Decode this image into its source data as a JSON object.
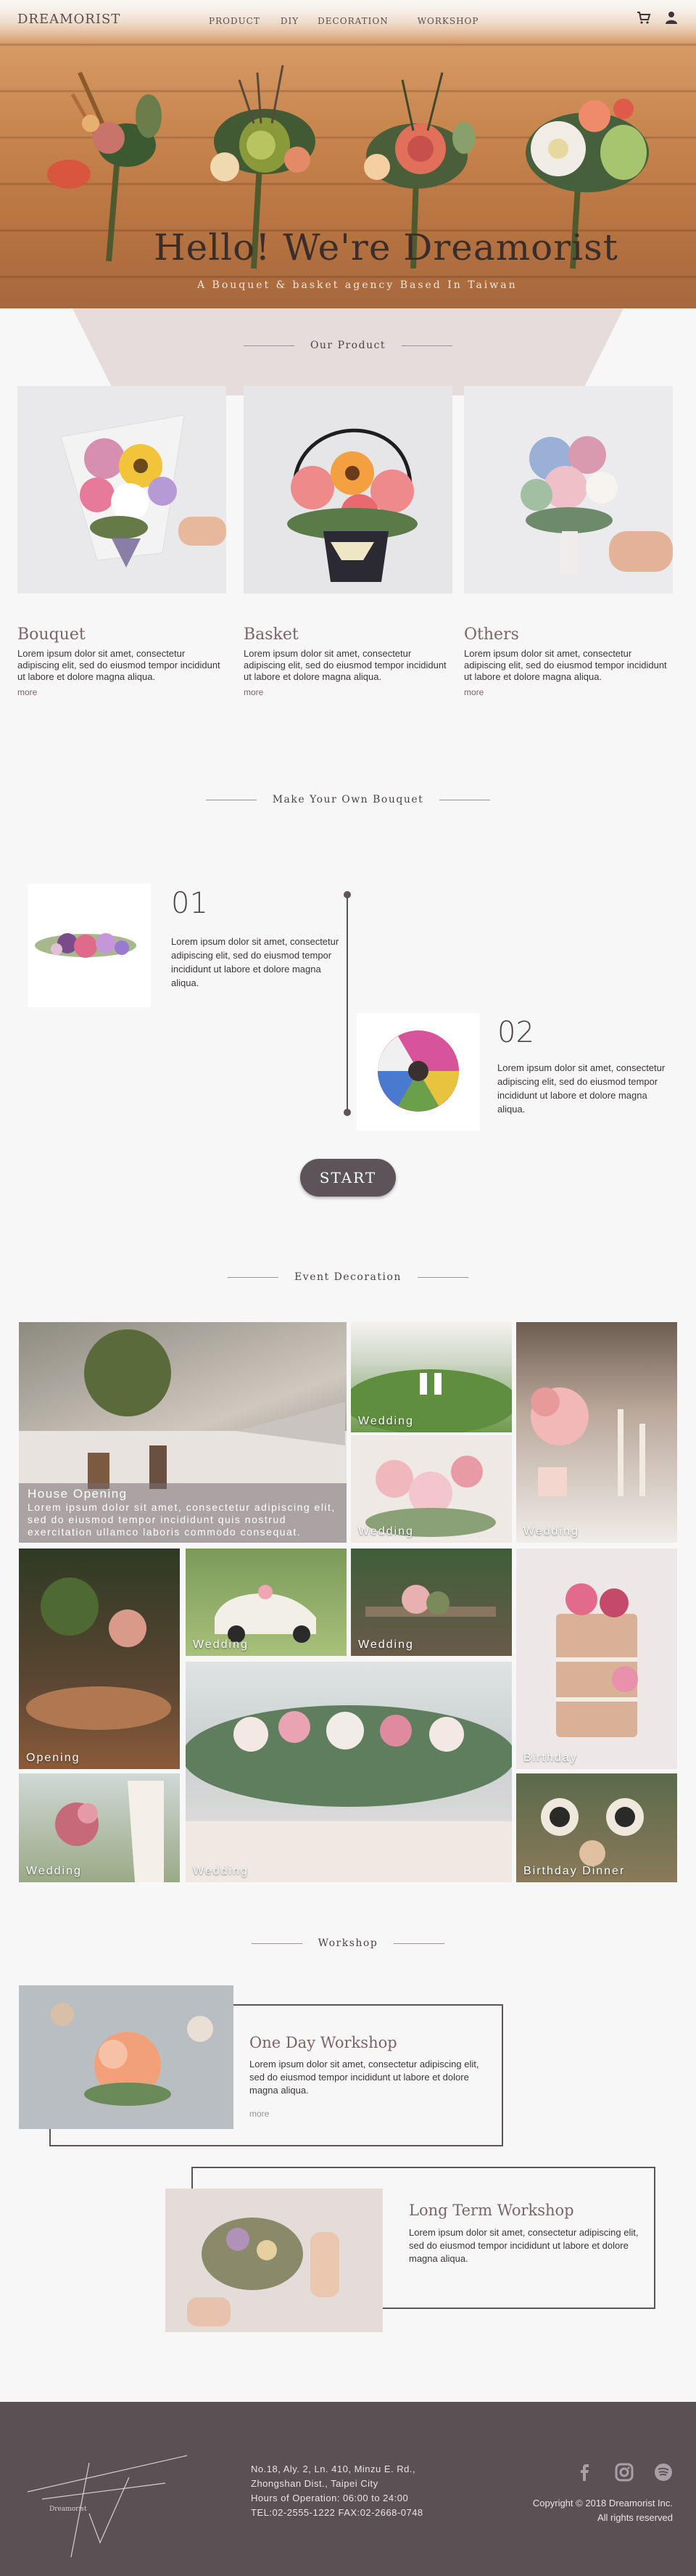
{
  "header": {
    "logo": "DREAMORIST",
    "nav": [
      "PRODUCT",
      "DIY",
      "DECORATION",
      "WORKSHOP"
    ],
    "icons": [
      "cart-icon",
      "user-icon"
    ]
  },
  "hero": {
    "title": "Hello! We're Dreamorist",
    "subtitle": "A Bouquet & basket agency Based In Taiwan"
  },
  "products": {
    "section_title": "Our Product",
    "items": [
      {
        "name": "Bouquet",
        "desc": "Lorem ipsum dolor sit amet, consectetur adipiscing elit, sed do eiusmod tempor incididunt ut labore et dolore magna aliqua.",
        "more": "more"
      },
      {
        "name": "Basket",
        "desc": "Lorem ipsum dolor sit amet, consectetur adipiscing elit, sed do eiusmod tempor incididunt ut labore et dolore magna aliqua.",
        "more": "more"
      },
      {
        "name": "Others",
        "desc": "Lorem ipsum dolor sit amet, consectetur adipiscing elit, sed do eiusmod tempor incididunt ut labore et dolore magna aliqua.",
        "more": "more"
      }
    ]
  },
  "diy": {
    "section_title": "Make Your Own Bouquet",
    "steps": [
      {
        "num": "01",
        "text": "Lorem ipsum dolor sit amet, consectetur adipiscing elit, sed do eiusmod tempor incididunt ut labore et dolore magna aliqua."
      },
      {
        "num": "02",
        "text": "Lorem ipsum dolor sit amet, consectetur adipiscing elit, sed do eiusmod tempor incididunt ut labore et dolore magna aliqua."
      }
    ],
    "start_label": "START"
  },
  "events": {
    "section_title": "Event Decoration",
    "feature": {
      "title": "House Opening",
      "text": "Lorem ipsum dolor sit amet, consectetur adipiscing elit, sed do eiusmod tempor incididunt quis nostrud exercitation ullamco laboris commodo consequat."
    },
    "labels": [
      "Wedding",
      "Wedding",
      "Wedding",
      "Wedding",
      "Wedding",
      "Opening",
      "Birthday",
      "Wedding",
      "Wedding",
      "Birthday Dinner"
    ]
  },
  "workshop": {
    "section_title": "Workshop",
    "items": [
      {
        "title": "One Day Workshop",
        "desc": "Lorem ipsum dolor sit amet, consectetur adipiscing elit, sed do eiusmod tempor incididunt ut labore et dolore magna aliqua.",
        "more": "more"
      },
      {
        "title": "Long Term Workshop",
        "desc": "Lorem ipsum dolor sit amet, consectetur adipiscing elit, sed do eiusmod tempor incididunt ut labore et dolore magna aliqua."
      }
    ]
  },
  "footer": {
    "address": [
      "No.18, Aly. 2, Ln. 410, Minzu E. Rd.,",
      "Zhongshan Dist., Taipei City",
      "Hours of Operation: 06:00 to 24:00",
      "TEL:02-2555-1222 FAX:02-2668-0748"
    ],
    "copyright": [
      "Copyright © 2018 Dreamorist Inc.",
      "All rights reserved"
    ],
    "logo_signature": "Dreamorist",
    "social": [
      "facebook-icon",
      "instagram-icon",
      "spotify-icon"
    ]
  },
  "colors": {
    "accent": "#5c5458",
    "text_rose": "#7c6469",
    "footer": "#5a5155",
    "pink": "#e5d9d8"
  }
}
